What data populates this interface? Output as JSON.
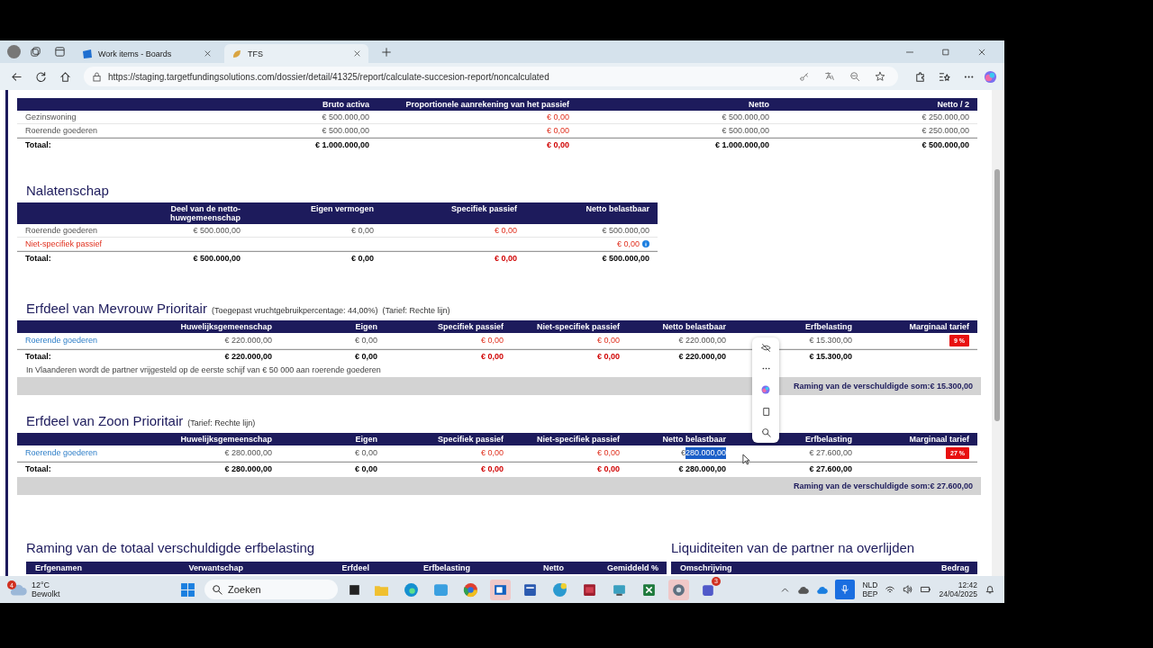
{
  "browser": {
    "tabs": [
      {
        "title": "Work items - Boards",
        "selected": false
      },
      {
        "title": "TFS",
        "selected": true
      }
    ],
    "url": "https://staging.targetfundingsolutions.com/dossier/detail/41325/report/calculate-succesion-report/noncalculated"
  },
  "huwelijksgemeenschap": {
    "columns": [
      {
        "kind": "label"
      },
      {
        "label": "Bruto activa",
        "kind": "amount"
      },
      {
        "label": "Proportionele aanrekening van het passief",
        "kind": "passive"
      },
      {
        "label": "Netto",
        "kind": "amount"
      },
      {
        "label": "Netto / 2",
        "kind": "amount"
      }
    ],
    "rows": [
      {
        "kind": "item",
        "cells": [
          "Gezinswoning",
          "€ 500.000,00",
          "€ 0,00",
          "€ 500.000,00",
          "€ 250.000,00"
        ]
      },
      {
        "kind": "item",
        "cells": [
          "Roerende goederen",
          "€ 500.000,00",
          "€ 0,00",
          "€ 500.000,00",
          "€ 250.000,00"
        ]
      },
      {
        "kind": "total",
        "cells": [
          "Totaal:",
          "€ 1.000.000,00",
          "€ 0,00",
          "€ 1.000.000,00",
          "€ 500.000,00"
        ]
      }
    ]
  },
  "nalatenschap": {
    "title": "Nalatenschap",
    "columns": [
      {
        "kind": "label"
      },
      {
        "label": "Deel van de netto-huwgemeenschap",
        "kind": "amount"
      },
      {
        "label": "Eigen vermogen",
        "kind": "amount"
      },
      {
        "label": "Specifiek passief",
        "kind": "passive"
      },
      {
        "label": "Netto belastbaar",
        "kind": "amount"
      }
    ],
    "rows": [
      {
        "kind": "item",
        "cells": [
          "Roerende goederen",
          "€ 500.000,00",
          "€ 0,00",
          "€ 0,00",
          "€ 500.000,00"
        ]
      },
      {
        "kind": "passive",
        "info": true,
        "cells": [
          "Niet-specifiek passief",
          null,
          null,
          null,
          "€ 0,00"
        ]
      },
      {
        "kind": "total",
        "cells": [
          "Totaal:",
          "€ 500.000,00",
          "€ 0,00",
          "€ 0,00",
          "€ 500.000,00"
        ]
      }
    ]
  },
  "erfdelen": [
    {
      "title": "Erfdeel van Mevrouw Prioritair",
      "notes": [
        "(Toegepast vruchtgebruikpercentage: 44,00%)",
        "(Tarief: Rechte lijn)"
      ],
      "columns": [
        {
          "kind": "label"
        },
        {
          "label": "Huwelijksgemeenschap",
          "kind": "amount"
        },
        {
          "label": "Eigen",
          "kind": "amount"
        },
        {
          "label": "Specifiek passief",
          "kind": "passive"
        },
        {
          "label": "Niet-specifiek passief",
          "kind": "passive"
        },
        {
          "label": "Netto belastbaar",
          "kind": "amount"
        },
        {
          "label": "Erfbelasting",
          "kind": "amount"
        },
        {
          "label": "Marginaal tarief",
          "kind": "badge"
        }
      ],
      "rows": [
        {
          "kind": "link",
          "cells": [
            "Roerende goederen",
            "€ 220.000,00",
            "€ 0,00",
            "€ 0,00",
            "€ 0,00",
            "€ 220.000,00",
            "€ 15.300,00",
            "9 %"
          ]
        },
        {
          "kind": "total",
          "cells": [
            "Totaal:",
            "€ 220.000,00",
            "€ 0,00",
            "€ 0,00",
            "€ 0,00",
            "€ 220.000,00",
            "€ 15.300,00",
            null
          ]
        }
      ],
      "footnote": "In Vlaanderen wordt de partner vrijgesteld op de eerste schijf van € 50 000 aan roerende goederen",
      "summary": "Raming van de verschuldigde som:€ 15.300,00"
    },
    {
      "title": "Erfdeel van Zoon Prioritair",
      "notes": [
        "(Tarief: Rechte lijn)"
      ],
      "columns": [
        {
          "kind": "label"
        },
        {
          "label": "Huwelijksgemeenschap",
          "kind": "amount"
        },
        {
          "label": "Eigen",
          "kind": "amount"
        },
        {
          "label": "Specifiek passief",
          "kind": "passive"
        },
        {
          "label": "Niet-specifiek passief",
          "kind": "passive"
        },
        {
          "label": "Netto belastbaar",
          "kind": "amount"
        },
        {
          "label": "Erfbelasting",
          "kind": "amount"
        },
        {
          "label": "Marginaal tarief",
          "kind": "badge"
        }
      ],
      "rows": [
        {
          "kind": "link",
          "cells": [
            "Roerende goederen",
            "€ 280.000,00",
            "€ 0,00",
            "€ 0,00",
            "€ 0,00",
            {
              "text": "€",
              "highlight": "280.000,00"
            },
            "€ 27.600,00",
            "27 %"
          ]
        },
        {
          "kind": "total",
          "cells": [
            "Totaal:",
            "€ 280.000,00",
            "€ 0,00",
            "€ 0,00",
            "€ 0,00",
            "€ 280.000,00",
            "€ 27.600,00",
            null
          ]
        }
      ],
      "summary": "Raming van de verschuldigde som:€ 27.600,00"
    }
  ],
  "totaal": {
    "title": "Raming van de totaal verschuldigde erfbelasting",
    "columns": [
      "Erfgenamen",
      "Verwantschap",
      "Erfdeel",
      "Erfbelasting",
      "Netto",
      "Gemiddeld %"
    ]
  },
  "liquiditeiten": {
    "title": "Liquiditeiten van de partner na overlijden",
    "columns": [
      "Omschrijving",
      "Bedrag"
    ]
  },
  "taskbar": {
    "weather": {
      "badge": "4",
      "temperature": "12°C",
      "condition": "Bewolkt"
    },
    "search": {
      "placeholder": "Zoeken"
    },
    "teams_badge": "3",
    "language": "NLD",
    "layout": "BEP",
    "time": "12:42",
    "date": "24/04/2025"
  }
}
